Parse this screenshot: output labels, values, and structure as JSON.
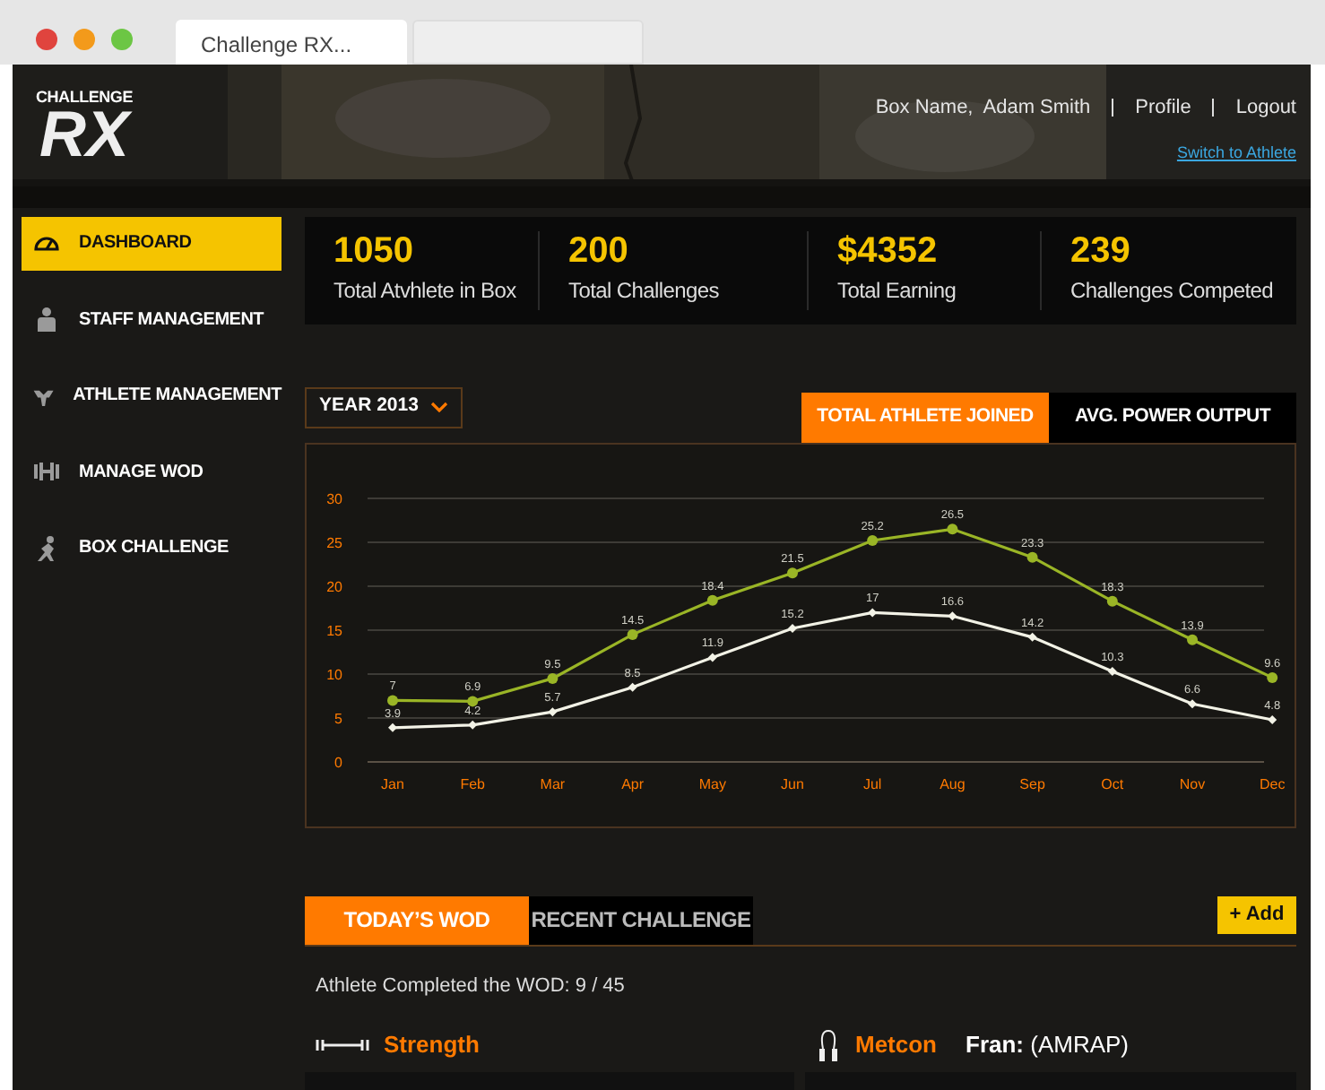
{
  "browser": {
    "tabs": [
      {
        "label": "Challenge RX...",
        "selected": true
      },
      {
        "selected": false
      }
    ]
  },
  "header": {
    "logo_top": "CHALLENGE",
    "logo_main": "RX",
    "user": "Box Name,  Adam Smith",
    "links": [
      "Profile",
      "Logout"
    ],
    "switch_link": "Switch to Athlete"
  },
  "sidebar": {
    "items": [
      {
        "label": "DASHBOARD",
        "selected": true
      },
      {
        "label": "STAFF MANAGEMENT",
        "selected": false
      },
      {
        "label": "ATHLETE MANAGEMENT",
        "selected": false
      },
      {
        "label": "MANAGE WOD",
        "selected": false
      },
      {
        "label": "BOX CHALLENGE",
        "selected": false
      }
    ]
  },
  "stats": [
    {
      "value": "1050",
      "label": "Total Atvhlete in Box"
    },
    {
      "value": "200",
      "label": "Total Challenges"
    },
    {
      "value": "$4352",
      "label": "Total Earning"
    },
    {
      "value": "239",
      "label": "Challenges Competed"
    }
  ],
  "year_select": {
    "value": "YEAR 2013"
  },
  "chart_tabs": [
    {
      "label": "TOTAL ATHLETE JOINED",
      "selected": true
    },
    {
      "label": "AVG. POWER OUTPUT",
      "selected": false
    }
  ],
  "chart_data": {
    "type": "line",
    "categories": [
      "Jan",
      "Feb",
      "Mar",
      "Apr",
      "May",
      "Jun",
      "Jul",
      "Aug",
      "Sep",
      "Oct",
      "Nov",
      "Dec"
    ],
    "ylim": [
      0,
      30
    ],
    "yticks": [
      0,
      5,
      10,
      15,
      20,
      25,
      30
    ],
    "data_labels": true,
    "grid": true,
    "series": [
      {
        "color": "#9ab526",
        "marker": "circle",
        "values": [
          7,
          6.9,
          9.5,
          14.5,
          18.4,
          21.5,
          25.2,
          26.5,
          23.3,
          18.3,
          13.9,
          9.6
        ]
      },
      {
        "color": "#f2f2e6",
        "marker": "diamond",
        "values": [
          3.9,
          4.2,
          5.7,
          8.5,
          11.9,
          15.2,
          17,
          16.6,
          14.2,
          10.3,
          6.6,
          4.8
        ]
      }
    ]
  },
  "wod_tabs": [
    {
      "label": "TODAY’S WOD",
      "selected": true
    },
    {
      "label": "RECENT CHALLENGE",
      "selected": false
    }
  ],
  "add_button": "+ Add",
  "wod_status": "Athlete Completed the WOD: 9 / 45",
  "sections": [
    {
      "kind": "strength",
      "title": "Strength"
    },
    {
      "kind": "metcon",
      "title": "Metcon",
      "name": "Fran:",
      "note": "(AMRAP)"
    }
  ]
}
